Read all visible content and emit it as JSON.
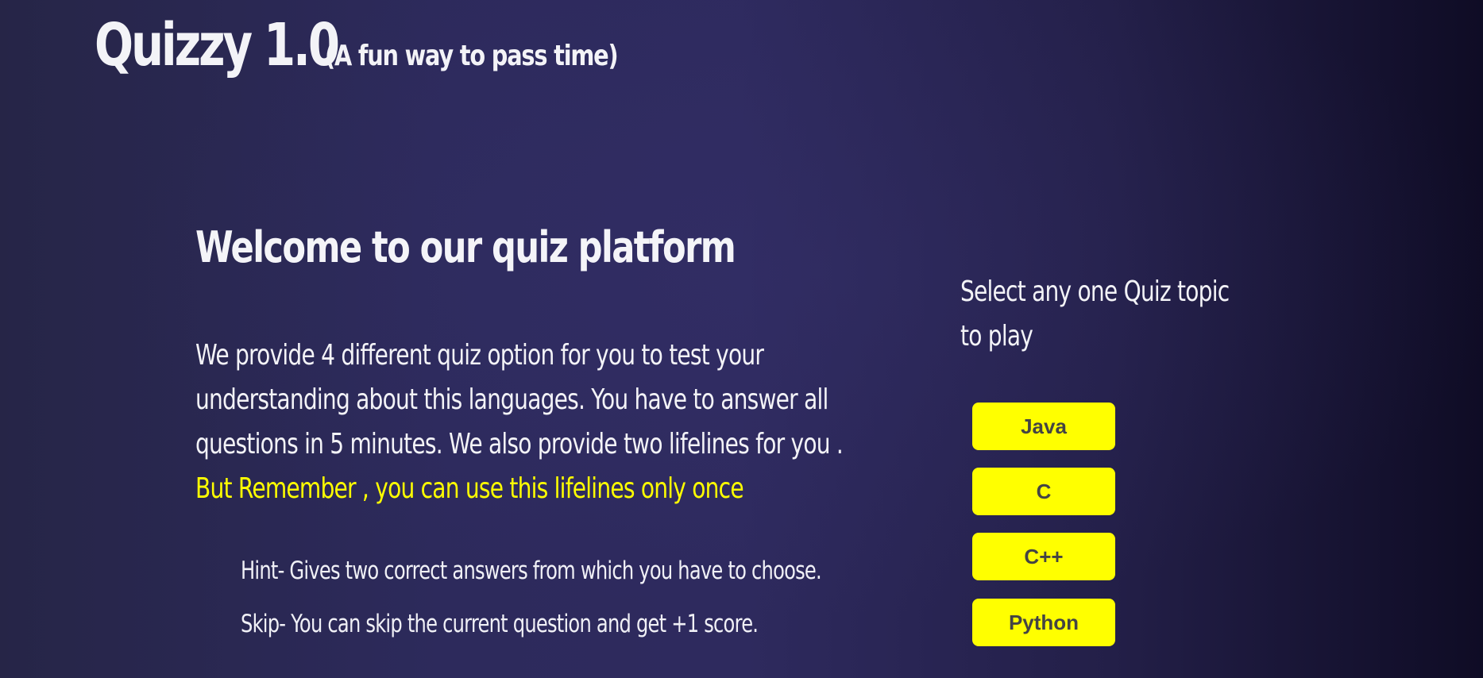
{
  "header": {
    "title": "Quizzy 1.0",
    "tagline": "(A fun way to pass time)"
  },
  "main": {
    "welcome_heading": "Welcome to our quiz platform",
    "intro_lines": [
      "We provide 4 different quiz option for you to test your",
      "understanding about this languages. You have to answer all",
      "questions in 5 minutes. We also provide two lifelines for you ."
    ],
    "warning": "But Remember , you can use this lifelines only once",
    "lifelines": [
      "Hint- Gives two correct answers from which you have to choose.",
      "Skip- You can skip the current question and get +1 score."
    ]
  },
  "topics": {
    "prompt_lines": [
      "Select any one Quiz topic",
      "to play"
    ],
    "buttons": [
      "Java",
      "C",
      "C++",
      "Python"
    ]
  },
  "colors": {
    "accent": "#ffff00",
    "button_text": "#444444",
    "background_start": "#262547",
    "background_end": "#0f0c25"
  }
}
